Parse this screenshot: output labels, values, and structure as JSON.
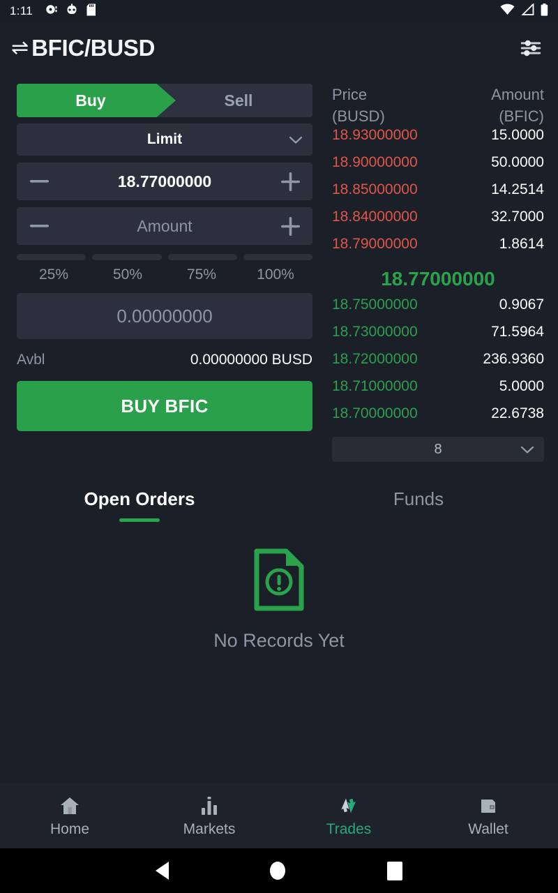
{
  "status_bar": {
    "time": "1:11",
    "left_icons": [
      "notification-dot-icon",
      "usb-debug-icon",
      "sd-card-icon"
    ],
    "right_icons": [
      "wifi-icon",
      "cellular-signal-icon",
      "battery-icon"
    ]
  },
  "app_bar": {
    "swap_icon": "⇌",
    "title": "BFIC/BUSD",
    "settings_icon": "sliders-icon"
  },
  "order_form": {
    "side_tabs": [
      {
        "label": "Buy",
        "active": true
      },
      {
        "label": "Sell",
        "active": false
      }
    ],
    "order_type": "Limit",
    "order_type_chevron": "chevron-down-icon",
    "price": {
      "value": "18.77000000",
      "minus": "−",
      "plus": "+"
    },
    "amount": {
      "placeholder": "Amount",
      "value": "",
      "minus": "−",
      "plus": "+"
    },
    "percent_options": [
      "25%",
      "50%",
      "75%",
      "100%"
    ],
    "total": "0.00000000",
    "available_label": "Avbl",
    "available_value": "0.00000000 BUSD",
    "submit_label": "BUY BFIC"
  },
  "order_book": {
    "header": {
      "price_line1": "Price",
      "price_line2": "(BUSD)",
      "amount_line1": "Amount",
      "amount_line2": "(BFIC)"
    },
    "asks": [
      {
        "price": "18.93000000",
        "amount": "15.0000"
      },
      {
        "price": "18.90000000",
        "amount": "50.0000"
      },
      {
        "price": "18.85000000",
        "amount": "14.2514"
      },
      {
        "price": "18.84000000",
        "amount": "32.7000"
      },
      {
        "price": "18.79000000",
        "amount": "1.8614"
      }
    ],
    "last_price": "18.77000000",
    "bids": [
      {
        "price": "18.75000000",
        "amount": "0.9067"
      },
      {
        "price": "18.73000000",
        "amount": "71.5964"
      },
      {
        "price": "18.72000000",
        "amount": "236.9360"
      },
      {
        "price": "18.71000000",
        "amount": "5.0000"
      },
      {
        "price": "18.70000000",
        "amount": "22.6738"
      }
    ],
    "decimals": "8",
    "decimals_chevron": "chevron-down-icon"
  },
  "lower_tabs": [
    {
      "label": "Open Orders",
      "active": true
    },
    {
      "label": "Funds",
      "active": false
    }
  ],
  "empty_state": {
    "icon": "document-alert-icon",
    "text": "No Records Yet"
  },
  "bottom_nav": [
    {
      "label": "Home",
      "icon": "home-icon",
      "active": false
    },
    {
      "label": "Markets",
      "icon": "bar-chart-icon",
      "active": false
    },
    {
      "label": "Trades",
      "icon": "exchange-arrows-icon",
      "active": true
    },
    {
      "label": "Wallet",
      "icon": "wallet-icon",
      "active": false
    }
  ],
  "system_nav": {
    "back": "back-triangle-icon",
    "home": "home-circle-icon",
    "recents": "recents-square-icon"
  },
  "colors": {
    "buy_green": "#2aa04a",
    "ask_red": "#e0564b",
    "bid_green": "#2e9e4f",
    "accent_teal": "#2aa97a",
    "page_bg": "#1b1f28",
    "field_bg": "#2b303c"
  }
}
